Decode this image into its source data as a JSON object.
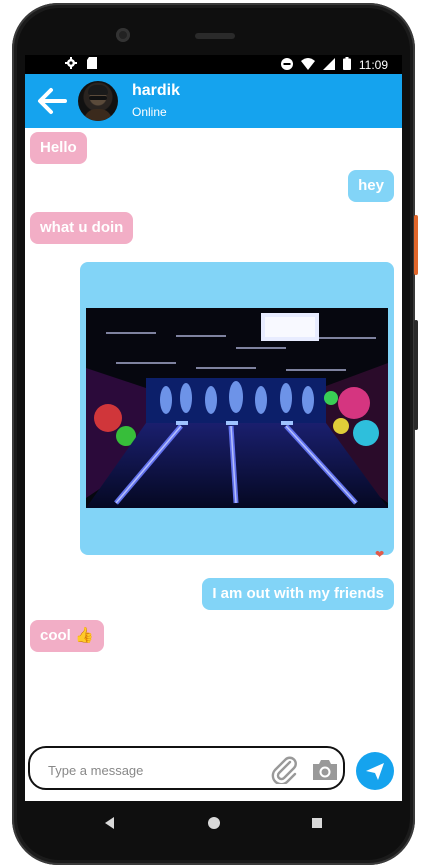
{
  "status_bar": {
    "time": "11:09",
    "left_icons": [
      "settings-icon",
      "sd-card-icon"
    ],
    "right_icons": [
      "do-not-disturb-icon",
      "wifi-icon",
      "signal-icon",
      "battery-icon"
    ]
  },
  "header": {
    "contact_name": "hardik",
    "contact_status": "Online"
  },
  "messages": [
    {
      "direction": "incoming",
      "text": "Hello"
    },
    {
      "direction": "outgoing",
      "text": "hey"
    },
    {
      "direction": "incoming",
      "text": "what u doin"
    },
    {
      "direction": "outgoing",
      "type": "image",
      "image_subject": "bowling alley with neon lights",
      "reaction": "heart"
    },
    {
      "direction": "outgoing",
      "text": "I am out with my friends"
    },
    {
      "direction": "incoming",
      "text": "cool 👍"
    }
  ],
  "input": {
    "placeholder": "Type a message",
    "value": ""
  },
  "colors": {
    "header": "#15a3ee",
    "incoming_bubble": "#f2aec6",
    "outgoing_bubble": "#82d4f7",
    "send_button": "#15a3ee"
  }
}
